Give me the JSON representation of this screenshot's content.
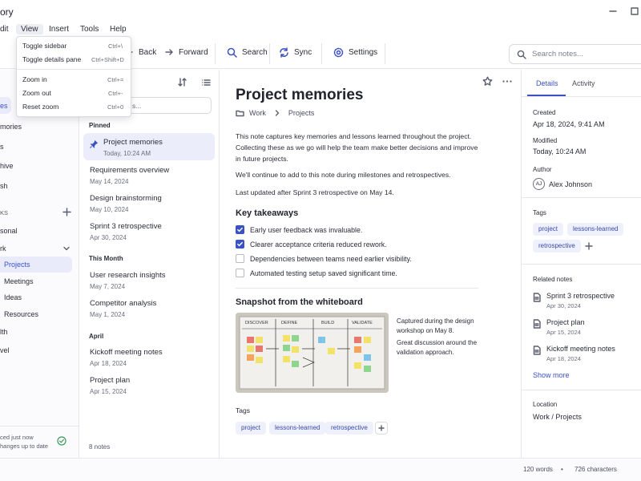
{
  "window": {
    "title_fragment": "ory"
  },
  "menubar": {
    "edit": "dit",
    "view": "View",
    "insert": "Insert",
    "tools": "Tools",
    "help": "Help"
  },
  "view_menu": {
    "items": [
      {
        "label": "Toggle sidebar",
        "shortcut": "Ctrl+\\"
      },
      {
        "label": "Toggle details pane",
        "shortcut": "Ctrl+Shift+D"
      },
      {
        "label": "Zoom in",
        "shortcut": "Ctrl+="
      },
      {
        "label": "Zoom out",
        "shortcut": "Ctrl+-"
      },
      {
        "label": "Reset zoom",
        "shortcut": "Ctrl+0"
      }
    ]
  },
  "toolbar": {
    "back": "Back",
    "forward": "Forward",
    "search": "Search",
    "sync": "Sync",
    "settings": "Settings",
    "search_placeholder": "Search notes..."
  },
  "sidebar": {
    "items": [
      "es",
      "mories",
      "s",
      "hive",
      "sh"
    ],
    "section": "KS",
    "notebooks": [
      "sonal",
      "rk",
      "Projects",
      "Meetings",
      "Ideas",
      "Resources",
      "lth",
      "vel"
    ],
    "sync_line1": "ced just now",
    "sync_line2": "hanges up to date"
  },
  "notelist": {
    "filter_value": "s...",
    "sections": {
      "pinned": "Pinned",
      "this_month": "This Month",
      "april": "April"
    },
    "pinned": [
      {
        "title": "Project memories",
        "date": "Today, 10:24 AM"
      }
    ],
    "recent": [
      {
        "title": "Requirements overview",
        "date": "May 14, 2024"
      },
      {
        "title": "Design brainstorming",
        "date": "May 10, 2024"
      },
      {
        "title": "Sprint 3 retrospective",
        "date": "Apr 30, 2024"
      }
    ],
    "this_month": [
      {
        "title": "User research insights",
        "date": "May 7, 2024"
      },
      {
        "title": "Competitor analysis",
        "date": "May 1, 2024"
      }
    ],
    "april": [
      {
        "title": "Kickoff meeting notes",
        "date": "Apr 18, 2024"
      },
      {
        "title": "Project plan",
        "date": "Apr 15, 2024"
      }
    ],
    "count": "8 notes"
  },
  "note": {
    "title": "Project memories",
    "breadcrumb": [
      "Work",
      "Projects"
    ],
    "paragraphs": [
      "This note captures key memories and lessons learned throughout the project. Collecting these as we go will help the team make better decisions and improve in future projects.",
      "We'll continue to add to this note during milestones and retrospectives.",
      "Last updated after Sprint 3 retrospective on May 14."
    ],
    "takeaways_heading": "Key takeaways",
    "takeaways": [
      {
        "text": "Early user feedback was invaluable.",
        "checked": true
      },
      {
        "text": "Clearer acceptance criteria reduced rework.",
        "checked": true
      },
      {
        "text": "Dependencies between teams need earlier visibility.",
        "checked": false
      },
      {
        "text": "Automated testing setup saved significant time.",
        "checked": false
      }
    ],
    "snapshot_heading": "Snapshot from the whiteboard",
    "whiteboard_columns": [
      "DISCOVER",
      "DEFINE",
      "BUILD",
      "VALIDATE"
    ],
    "caption1": "Captured during the design workshop on May 8.",
    "caption2": "Great discussion around the validation approach.",
    "tags_label": "Tags",
    "tags": [
      "project",
      "lessons-learned",
      "retrospective"
    ]
  },
  "details": {
    "tab_details": "Details",
    "tab_activity": "Activity",
    "created_label": "Created",
    "created": "Apr 18, 2024, 9:41 AM",
    "modified_label": "Modified",
    "modified": "Today, 10:24 AM",
    "author_label": "Author",
    "author_initials": "AJ",
    "author": "Alex Johnson",
    "tags_label": "Tags",
    "tags": [
      "project",
      "lessons-learned",
      "retrospective"
    ],
    "related_label": "Related notes",
    "related": [
      {
        "title": "Sprint 3 retrospective",
        "date": "Apr 30, 2024"
      },
      {
        "title": "Project plan",
        "date": "Apr 15, 2024"
      },
      {
        "title": "Kickoff meeting notes",
        "date": "Apr 18, 2024"
      }
    ],
    "show_more": "Show more",
    "location_label": "Location",
    "location": "Work / Projects"
  },
  "status": {
    "words": "120 words",
    "dot": "•",
    "characters": "726 characters"
  },
  "colors": {
    "accent": "#3b52c4",
    "selection": "#ecedfb",
    "tag_bg": "#eef0fb"
  }
}
